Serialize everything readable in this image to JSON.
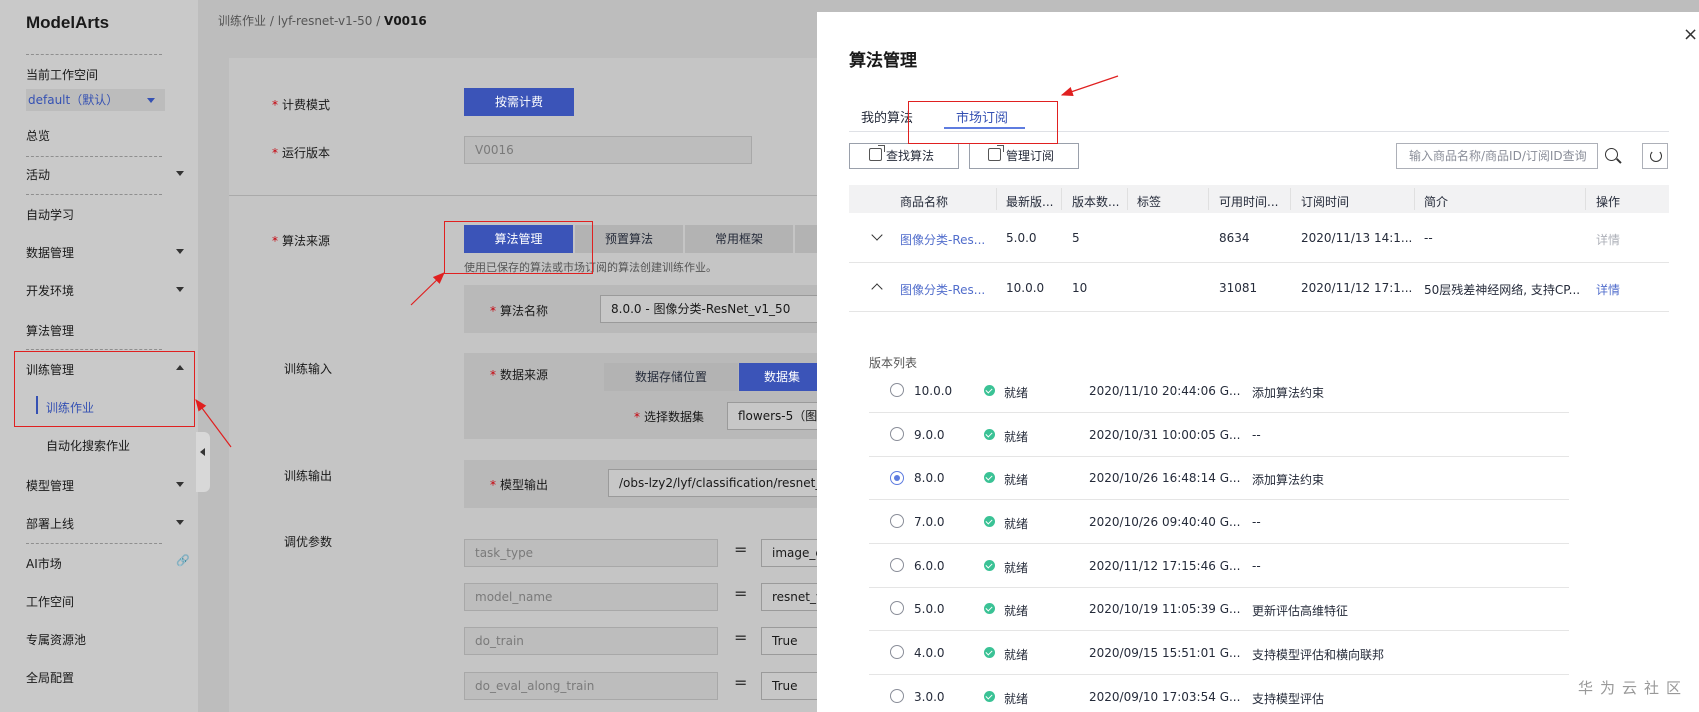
{
  "sidebar": {
    "logo": "ModelArts",
    "workspace_label": "当前工作空间",
    "workspace_value": "default（默认）",
    "items": [
      {
        "label": "总览"
      },
      {
        "label": "活动"
      },
      {
        "label": "自动学习"
      },
      {
        "label": "数据管理"
      },
      {
        "label": "开发环境"
      },
      {
        "label": "算法管理"
      },
      {
        "label": "训练管理"
      },
      {
        "label": "训练作业"
      },
      {
        "label": "自动化搜索作业"
      },
      {
        "label": "模型管理"
      },
      {
        "label": "部署上线"
      },
      {
        "label": "AI市场"
      },
      {
        "label": "工作空间"
      },
      {
        "label": "专属资源池"
      },
      {
        "label": "全局配置"
      }
    ]
  },
  "breadcrumb": {
    "part1": "训练作业",
    "part2": "lyf-resnet-v1-50",
    "current": "V0016"
  },
  "form": {
    "billing_label": "计费模式",
    "billing_value": "按需计费",
    "version_label": "运行版本",
    "version_value": "V0016",
    "algo_source_label": "算法来源",
    "algo_tabs": [
      "算法管理",
      "预置算法",
      "常用框架"
    ],
    "algo_hint": "使用已保存的算法或市场订阅的算法创建训练作业。",
    "algo_name_label": "算法名称",
    "algo_name_value": "8.0.0 - 图像分类-ResNet_v1_50",
    "train_input_label": "训练输入",
    "data_source_label": "数据来源",
    "data_source_tabs": [
      "数据存储位置",
      "数据集"
    ],
    "dataset_label": "选择数据集",
    "dataset_value": "flowers-5（图像",
    "train_output_label": "训练输出",
    "model_output_label": "模型输出",
    "model_output_value": "/obs-lzy2/lyf/classification/resnet_v1",
    "tune_label": "调优参数",
    "params": [
      {
        "key": "task_type",
        "value": "image_c"
      },
      {
        "key": "model_name",
        "value": "resnet_v"
      },
      {
        "key": "do_train",
        "value": "True"
      },
      {
        "key": "do_eval_along_train",
        "value": "True"
      }
    ],
    "eq": "="
  },
  "drawer": {
    "title": "算法管理",
    "close": "×",
    "tabs": [
      "我的算法",
      "市场订阅"
    ],
    "find_btn": "查找算法",
    "manage_btn": "管理订阅",
    "search_placeholder": "输入商品名称/商品ID/订阅ID查询",
    "columns": [
      "商品名称",
      "最新版...",
      "版本数...",
      "标签",
      "可用时间...",
      "订阅时间",
      "简介",
      "操作"
    ],
    "rows": [
      {
        "name": "图像分类-Res...",
        "latest": "5.0.0",
        "count": "5",
        "tag": "",
        "avail": "8634",
        "sub_time": "2020/11/13 14:1...",
        "intro": "--",
        "op": "详情"
      },
      {
        "name": "图像分类-Res...",
        "latest": "10.0.0",
        "count": "10",
        "tag": "",
        "avail": "31081",
        "sub_time": "2020/11/12 17:1...",
        "intro": "50层残差神经网络, 支持CP...",
        "op": "详情"
      }
    ],
    "version_list_title": "版本列表",
    "versions": [
      {
        "ver": "10.0.0",
        "status": "就绪",
        "time": "2020/11/10 20:44:06 G...",
        "desc": "添加算法约束"
      },
      {
        "ver": "9.0.0",
        "status": "就绪",
        "time": "2020/10/31 10:00:05 G...",
        "desc": "--"
      },
      {
        "ver": "8.0.0",
        "status": "就绪",
        "time": "2020/10/26 16:48:14 G...",
        "desc": "添加算法约束"
      },
      {
        "ver": "7.0.0",
        "status": "就绪",
        "time": "2020/10/26 09:40:40 G...",
        "desc": "--"
      },
      {
        "ver": "6.0.0",
        "status": "就绪",
        "time": "2020/11/12 17:15:46 G...",
        "desc": "--"
      },
      {
        "ver": "5.0.0",
        "status": "就绪",
        "time": "2020/10/19 11:05:39 G...",
        "desc": "更新评估高维特征"
      },
      {
        "ver": "4.0.0",
        "status": "就绪",
        "time": "2020/09/15 15:51:01 G...",
        "desc": "支持模型评估和横向联邦"
      },
      {
        "ver": "3.0.0",
        "status": "就绪",
        "time": "2020/09/10 17:03:54 G...",
        "desc": "支持模型评估"
      }
    ]
  },
  "watermark": "华为云社区"
}
